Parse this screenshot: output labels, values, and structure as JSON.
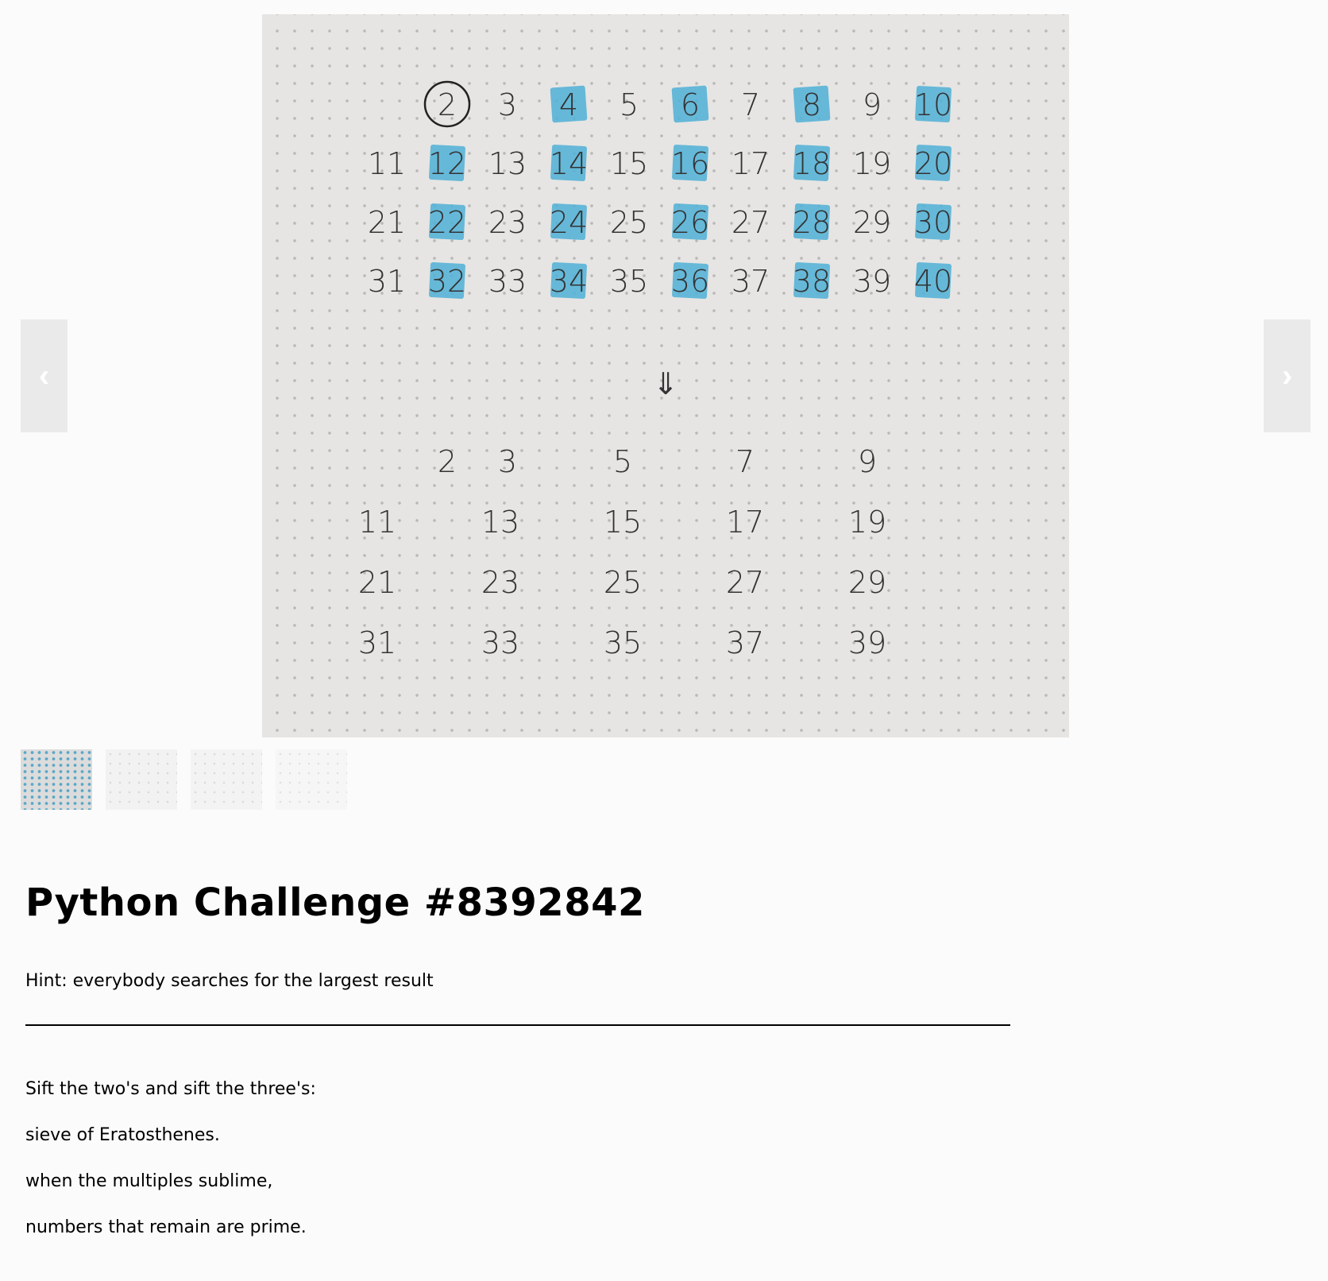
{
  "carousel": {
    "prev_icon": "chevron-left-icon",
    "next_icon": "chevron-right-icon",
    "prev_glyph": "‹",
    "next_glyph": "›"
  },
  "sieve_image": {
    "top_rows": [
      [
        "2",
        "3",
        "4",
        "5",
        "6",
        "7",
        "8",
        "9",
        "10"
      ],
      [
        "11",
        "12",
        "13",
        "14",
        "15",
        "16",
        "17",
        "18",
        "19",
        "20"
      ],
      [
        "21",
        "22",
        "23",
        "24",
        "25",
        "26",
        "27",
        "28",
        "29",
        "30"
      ],
      [
        "31",
        "32",
        "33",
        "34",
        "35",
        "36",
        "37",
        "38",
        "39",
        "40"
      ]
    ],
    "circled": [
      "2"
    ],
    "highlighted": [
      "4",
      "6",
      "8",
      "10",
      "12",
      "14",
      "16",
      "18",
      "20",
      "22",
      "24",
      "26",
      "28",
      "30",
      "32",
      "34",
      "36",
      "38",
      "40"
    ],
    "highlight_color": "#4fb0d6",
    "arrow_glyph": "⇓",
    "bottom_rows": [
      [
        "2",
        "3",
        "5",
        "7",
        "9"
      ],
      [
        "11",
        "13",
        "15",
        "17",
        "19"
      ],
      [
        "21",
        "23",
        "25",
        "27",
        "29"
      ],
      [
        "31",
        "33",
        "35",
        "37",
        "39"
      ]
    ]
  },
  "thumbnails": [
    {
      "active": true
    },
    {
      "active": false
    },
    {
      "active": false
    },
    {
      "active": false
    }
  ],
  "title": "Python Challenge #8392842",
  "hint": "Hint: everybody searches for the largest result",
  "poem": [
    "Sift the two's and sift the three's:",
    "sieve of Eratosthenes.",
    "when the multiples sublime,",
    "numbers that remain are prime."
  ]
}
